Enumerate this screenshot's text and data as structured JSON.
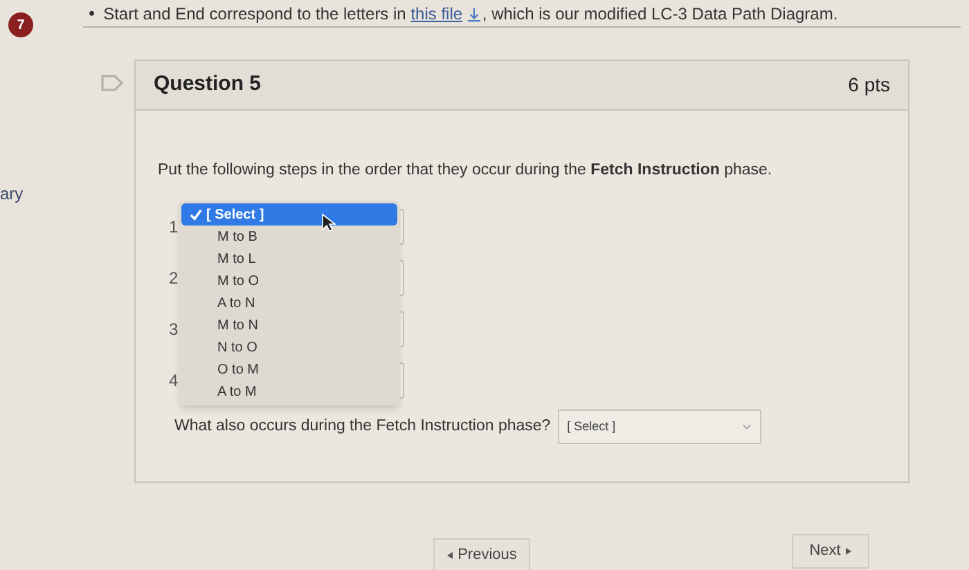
{
  "instruction": {
    "bullet": "•",
    "text_before": "Start and End correspond to the letters in ",
    "link": "this file",
    "text_after": ", which is our modified LC-3 Data Path Diagram."
  },
  "question_number_badge": "7",
  "sidebar_fragment": "ary",
  "question": {
    "title": "Question 5",
    "points": "6 pts",
    "prompt": "Put the following steps in the order that they occur during the **Fetch Instruction** phase.",
    "steps": [
      "1",
      "2",
      "3",
      "4"
    ],
    "dropdown_options": [
      {
        "label": "[ Select ]",
        "selected": true
      },
      {
        "label": "M to B",
        "selected": false
      },
      {
        "label": "M to L",
        "selected": false
      },
      {
        "label": "M to O",
        "selected": false
      },
      {
        "label": "A to N",
        "selected": false
      },
      {
        "label": "M to N",
        "selected": false
      },
      {
        "label": "N to O",
        "selected": false
      },
      {
        "label": "O to M",
        "selected": false
      },
      {
        "label": "A to M",
        "selected": false
      }
    ],
    "followup": {
      "label": "What also occurs during the Fetch Instruction phase?",
      "value": "[ Select ]"
    }
  },
  "nav": {
    "previous": "Previous",
    "next": "Next"
  }
}
